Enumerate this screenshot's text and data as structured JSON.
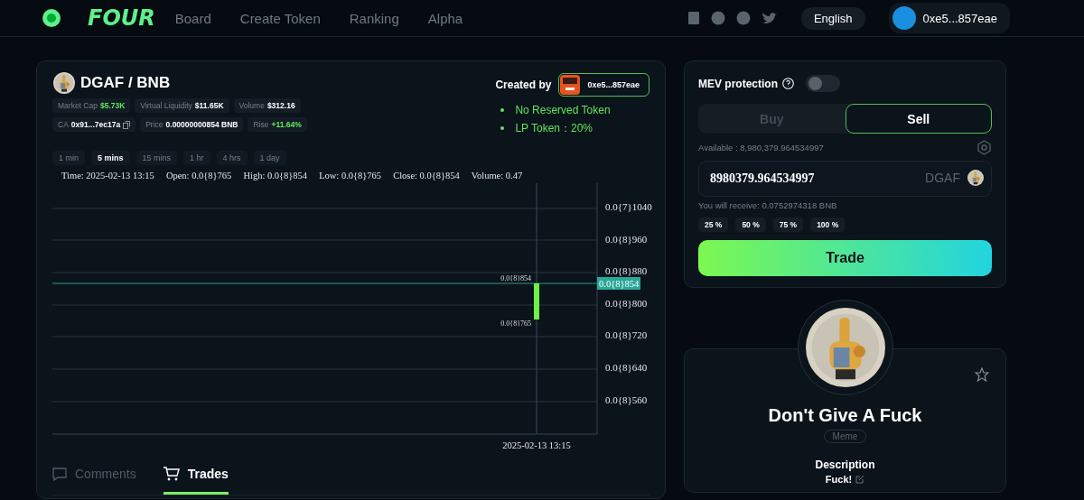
{
  "header": {
    "logo": "FOUR",
    "nav": [
      "Board",
      "Create Token",
      "Ranking",
      "Alpha"
    ],
    "language": "English",
    "wallet": "0xe5...857eae"
  },
  "pair": {
    "title": "DGAF / BNB",
    "stats": [
      [
        {
          "label": "Market Cap",
          "value": "$5.73K",
          "positive": true,
          "copyable": false
        },
        {
          "label": "Virtual Liquidity",
          "value": "$11.65K",
          "positive": false,
          "copyable": false
        },
        {
          "label": "Volume",
          "value": "$312.16",
          "positive": false,
          "copyable": false
        }
      ],
      [
        {
          "label": "CA",
          "value": "0x91...7ec17a",
          "positive": false,
          "copyable": true
        },
        {
          "label": "Price",
          "value": "0.00000000854 BNB",
          "positive": false,
          "copyable": false
        },
        {
          "label": "Rise",
          "value": "+11.64%",
          "positive": true,
          "copyable": false
        }
      ]
    ]
  },
  "creator": {
    "label": "Created by",
    "address": "0xe5...857eae",
    "notes": [
      "No Reserved Token",
      "LP Token：20%"
    ]
  },
  "intervals": [
    {
      "label": "1 min",
      "selected": false
    },
    {
      "label": "5 mins",
      "selected": true
    },
    {
      "label": "15 mins",
      "selected": false
    },
    {
      "label": "1 hr",
      "selected": false
    },
    {
      "label": "4 hrs",
      "selected": false
    },
    {
      "label": "1 day",
      "selected": false
    }
  ],
  "chart": {
    "legend": [
      "Time: 2025-02-13 13:15",
      "Open: 0.0{8}765",
      "High: 0.0{8}854",
      "Low: 0.0{8}765",
      "Close: 0.0{8}854",
      "Volume: 0.47"
    ],
    "y_labels": [
      "0.0{7}1040",
      "0.0{8}960",
      "0.0{8}880",
      "0.0{8}800",
      "0.0{8}720",
      "0.0{8}640",
      "0.0{8}560"
    ],
    "last_price": "0.0{8}854",
    "high_label": "0.0{8}854",
    "low_label": "0.0{8}765",
    "x_label": "2025-02-13 13:15"
  },
  "bottom_tabs": [
    {
      "label": "Comments",
      "kind": "comments",
      "selected": false
    },
    {
      "label": "Trades",
      "kind": "trades",
      "selected": true
    }
  ],
  "trade": {
    "mev_label": "MEV protection",
    "mev_on": false,
    "sides": [
      {
        "label": "Buy",
        "selected": false
      },
      {
        "label": "Sell",
        "selected": true
      }
    ],
    "available": "Available : 8,980,379.964534997",
    "amount": "8980379.964534997",
    "token": "DGAF",
    "receive": "You will receive: 0.0752974318 BNB",
    "presets": [
      "25 %",
      "50 %",
      "75 %",
      "100 %"
    ],
    "action": "Trade"
  },
  "token": {
    "name": "Don't Give A Fuck",
    "tag": "Meme",
    "description_label": "Description",
    "description": "Fuck!"
  }
}
